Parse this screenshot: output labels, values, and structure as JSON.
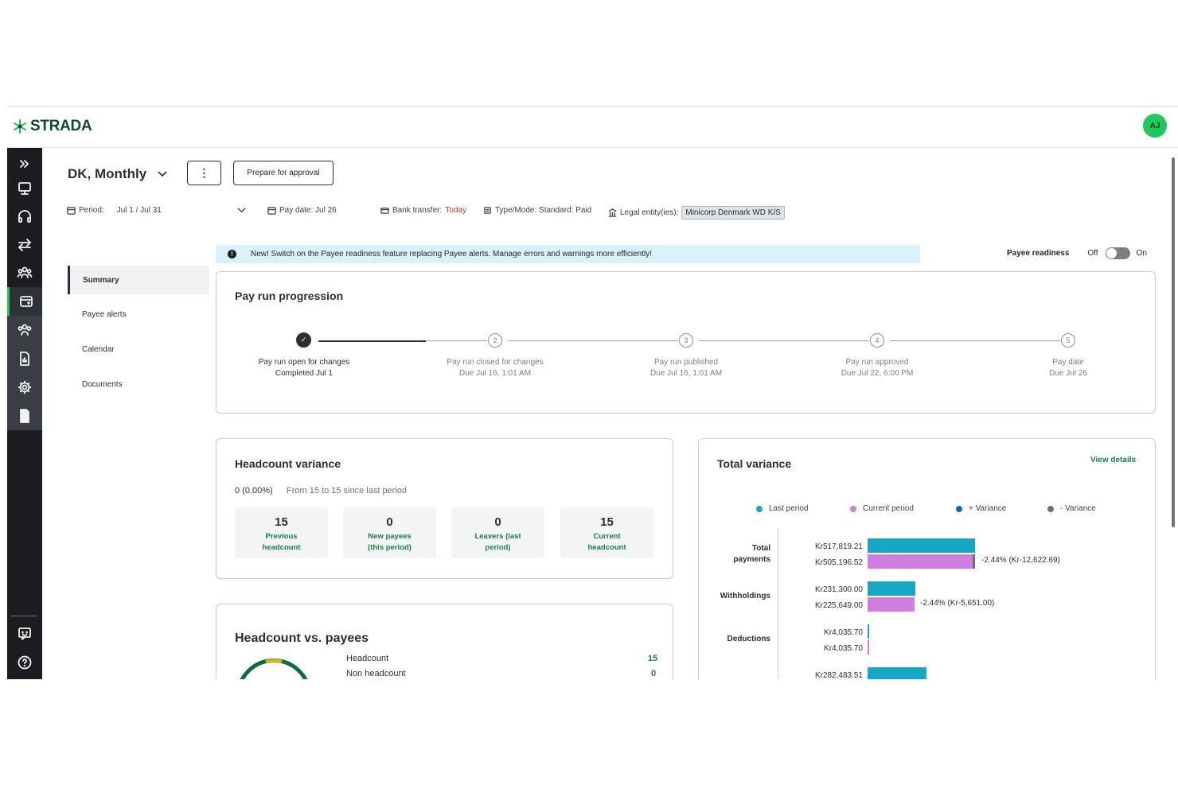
{
  "app": {
    "brand": "STRADA",
    "user_initials": "AJ"
  },
  "colors": {
    "brand_green": "#1fc85a",
    "last_period": "#17a6c4",
    "current_period": "#d07de0",
    "plus_variance": "#1565c0",
    "minus_variance": "#6b7078"
  },
  "rail": {
    "items": [
      "expand-icon",
      "monitor-icon",
      "headset-icon",
      "transfer-icon",
      "people-icon",
      "wallet-icon",
      "team-icon",
      "report-icon",
      "gear-icon",
      "document-icon",
      "feedback-icon",
      "help-icon"
    ]
  },
  "header": {
    "run_title": "DK, Monthly",
    "kebab": "⋮",
    "prepare_label": "Prepare for approval",
    "period_label": "Period:",
    "period_value": "Jul 1 / Jul 31",
    "pay_date": "Pay date: Jul 26",
    "bank_label": "Bank transfer:",
    "bank_value": "Today",
    "type_mode": "Type/Mode: Standard: Paid",
    "legal_label": "Legal entity(ies):",
    "legal_value": "Minicorp Denmark WD K/S"
  },
  "sidenav": {
    "items": [
      "Summary",
      "Payee alerts",
      "Calendar",
      "Documents"
    ]
  },
  "banner": {
    "text": "New! Switch on the Payee readiness feature replacing Payee alerts. Manage errors and warnings more efficiently!",
    "readiness_label": "Payee readiness",
    "off": "Off",
    "on": "On"
  },
  "progression": {
    "title": "Pay run progression",
    "steps": [
      {
        "num": "✓",
        "name": "Pay run open for changes",
        "sub": "Completed Jul 1"
      },
      {
        "num": "2",
        "name": "Pay run closed for changes",
        "sub": "Due Jul 16, 1:01 AM"
      },
      {
        "num": "3",
        "name": "Pay run published",
        "sub": "Due Jul 16, 1:01 AM"
      },
      {
        "num": "4",
        "name": "Pay run approved",
        "sub": "Due Jul 22, 6:00 PM"
      },
      {
        "num": "5",
        "name": "Pay date",
        "sub": "Due Jul 26"
      }
    ]
  },
  "headcount": {
    "title": "Headcount variance",
    "change": "0 (0.00%)",
    "summary": "From 15 to 15 since last period",
    "tiles": [
      {
        "value": "15",
        "label_1": "Previous",
        "label_2": "headcount"
      },
      {
        "value": "0",
        "label_1": "New payees",
        "label_2": "(this period)"
      },
      {
        "value": "0",
        "label_1": "Leavers (last",
        "label_2": "period)"
      },
      {
        "value": "15",
        "label_1": "Current",
        "label_2": "headcount"
      }
    ]
  },
  "hvp": {
    "title": "Headcount vs. payees",
    "rows": [
      {
        "label": "Headcount",
        "value": "15"
      },
      {
        "label": "Non headcount",
        "value": "0"
      }
    ]
  },
  "variance": {
    "title": "Total variance",
    "view_details": "View details",
    "legend": [
      "Last period",
      "Current period",
      "+ Variance",
      "- Variance"
    ],
    "categories": [
      {
        "label_1": "Total",
        "label_2": "payments",
        "last": "Kr517,819.21",
        "current": "Kr505,196.52",
        "variance": "-2.44% (Kr-12,622.69)"
      },
      {
        "label_1": "Withholdings",
        "label_2": "",
        "last": "Kr231,300.00",
        "current": "Kr225,649.00",
        "variance": "-2.44% (Kr-5,651.00)"
      },
      {
        "label_1": "Deductions",
        "label_2": "",
        "last": "Kr4,035.70",
        "current": "Kr4,035.70",
        "variance": ""
      },
      {
        "label_1": "",
        "label_2": "",
        "last": "Kr282,483.51",
        "current": "",
        "variance": ""
      }
    ]
  },
  "chart_data": {
    "type": "bar",
    "title": "Total variance",
    "categories": [
      "Total payments",
      "Withholdings",
      "Deductions",
      ""
    ],
    "series": [
      {
        "name": "Last period",
        "values": [
          517819.21,
          231300.0,
          4035.7,
          282483.51
        ]
      },
      {
        "name": "Current period",
        "values": [
          505196.52,
          225649.0,
          4035.7,
          null
        ]
      }
    ]
  }
}
